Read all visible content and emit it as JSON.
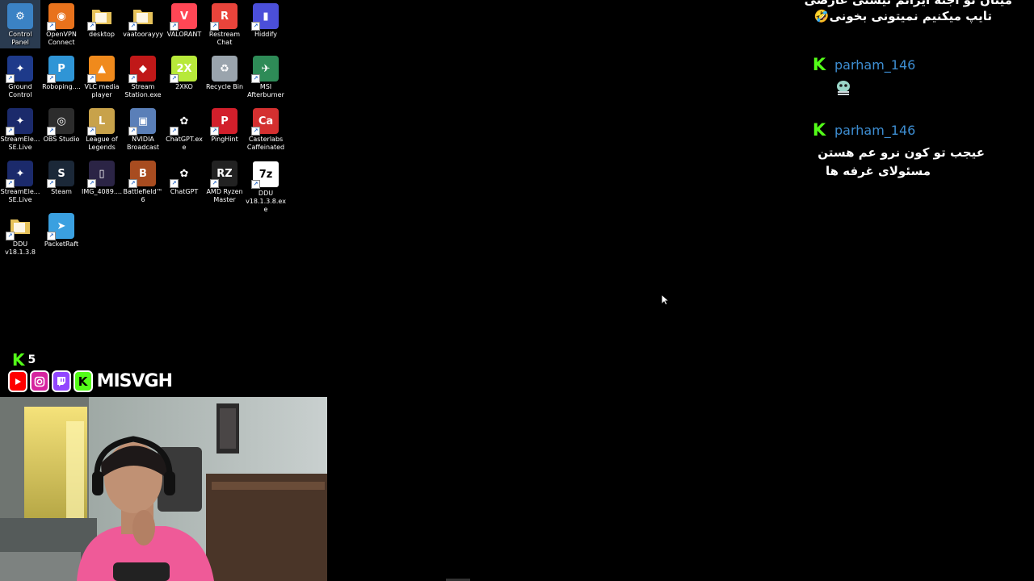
{
  "desktop": {
    "icons": [
      {
        "label": "Control Panel",
        "icon": "control-panel-icon",
        "color": "#3b82c4"
      },
      {
        "label": "OpenVPN Connect",
        "icon": "openvpn-icon",
        "color": "#e8721c"
      },
      {
        "label": "desktop",
        "icon": "folder-icon",
        "color": "#e6c25a"
      },
      {
        "label": "vaatoorayyy",
        "icon": "folder-icon",
        "color": "#e6c25a"
      },
      {
        "label": "VALORANT",
        "icon": "valorant-icon",
        "color": "#ff4655"
      },
      {
        "label": "Restream Chat",
        "icon": "restream-icon",
        "color": "#e9443b"
      },
      {
        "label": "Hiddify",
        "icon": "hiddify-icon",
        "color": "#4b4fd9"
      },
      {
        "label": "Ground Control",
        "icon": "ground-control-icon",
        "color": "#1e3a8a"
      },
      {
        "label": "Roboping....",
        "icon": "roboping-icon",
        "color": "#2f95d6"
      },
      {
        "label": "VLC media player",
        "icon": "vlc-icon",
        "color": "#f08a1c"
      },
      {
        "label": "Stream Station.exe",
        "icon": "stream-station-icon",
        "color": "#c01818"
      },
      {
        "label": "2XKO",
        "icon": "2xko-icon",
        "color": "#b7e93a"
      },
      {
        "label": "Recycle Bin",
        "icon": "recycle-bin-icon",
        "color": "#9aa4ad"
      },
      {
        "label": "MSI Afterburner",
        "icon": "msi-afterburner-icon",
        "color": "#2e8b57"
      },
      {
        "label": "StreamEle... SE.Live",
        "icon": "streamelements-icon",
        "color": "#1b2a6b"
      },
      {
        "label": "OBS Studio",
        "icon": "obs-icon",
        "color": "#2c2c2c"
      },
      {
        "label": "League of Legends",
        "icon": "league-of-legends-icon",
        "color": "#c8a24a"
      },
      {
        "label": "NVIDIA Broadcast",
        "icon": "nvidia-broadcast-icon",
        "color": "#5a7fb8"
      },
      {
        "label": "ChatGPT.exe",
        "icon": "chatgpt-icon",
        "color": "#000000"
      },
      {
        "label": "PingHint",
        "icon": "pinghint-icon",
        "color": "#d21f2b"
      },
      {
        "label": "Casterlabs Caffeinated",
        "icon": "casterlabs-icon",
        "color": "#d43030"
      },
      {
        "label": "StreamEle... SE.Live",
        "icon": "streamelements-icon",
        "color": "#1b2a6b"
      },
      {
        "label": "Steam",
        "icon": "steam-icon",
        "color": "#1b2838"
      },
      {
        "label": "IMG_4089....",
        "icon": "image-file-icon",
        "color": "#2b2445"
      },
      {
        "label": "Battlefield™ 6",
        "icon": "battlefield-icon",
        "color": "#a84c20"
      },
      {
        "label": "ChatGPT",
        "icon": "chatgpt-icon",
        "color": "#000000"
      },
      {
        "label": "AMD Ryzen Master",
        "icon": "amd-ryzen-icon",
        "color": "#222222"
      },
      {
        "label": "DDU v18.1.3.8.exe",
        "icon": "7zip-icon",
        "color": "#ffffff"
      },
      {
        "label": "DDU v18.1.3.8",
        "icon": "folder-icon",
        "color": "#e6c25a"
      },
      {
        "label": "PacketRaft",
        "icon": "packetraft-icon",
        "color": "#3aa0e0"
      }
    ]
  },
  "chat": {
    "partial_top": "میتان تو اجنه ایرانم نیستی عارضی",
    "line_top": "تایپ میکنیم نمیتونی بخونی🤣",
    "messages": [
      {
        "username": "parham_146",
        "text": "😶‍🌫️"
      },
      {
        "username": "parham_146",
        "text_line1": "عیجب تو کون نرو عم هستن",
        "text_line2": "مسئولای غرفه ها"
      }
    ]
  },
  "overlay": {
    "viewer_count": "5",
    "handle": "MISVGH",
    "colors": {
      "kick": "#53fc18",
      "youtube": "#ff0000",
      "instagram": "#d6249f",
      "twitch": "#9146ff"
    }
  }
}
